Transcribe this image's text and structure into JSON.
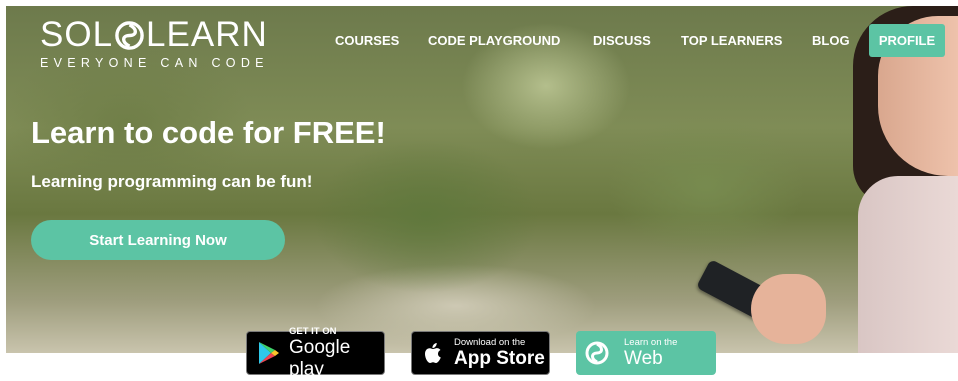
{
  "brand": {
    "name_part1": "SOL",
    "name_part2": "LEARN",
    "tagline": "EVERYONE CAN CODE",
    "accent_color": "#5cc4a4"
  },
  "nav": {
    "items": [
      {
        "label": "COURSES"
      },
      {
        "label": "CODE PLAYGROUND"
      },
      {
        "label": "DISCUSS"
      },
      {
        "label": "TOP LEARNERS"
      },
      {
        "label": "BLOG"
      }
    ],
    "profile_label": "PROFILE"
  },
  "hero": {
    "headline": "Learn to code for FREE!",
    "subheadline": "Learning programming can be fun!",
    "cta_label": "Start Learning Now"
  },
  "badges": {
    "google_play": {
      "small": "GET IT ON",
      "big": "Google play",
      "icon": "google-play-icon"
    },
    "app_store": {
      "small": "Download on the",
      "big": "App Store",
      "icon": "apple-icon"
    },
    "web": {
      "small": "Learn on the",
      "big": "Web",
      "icon": "sololearn-icon"
    }
  }
}
